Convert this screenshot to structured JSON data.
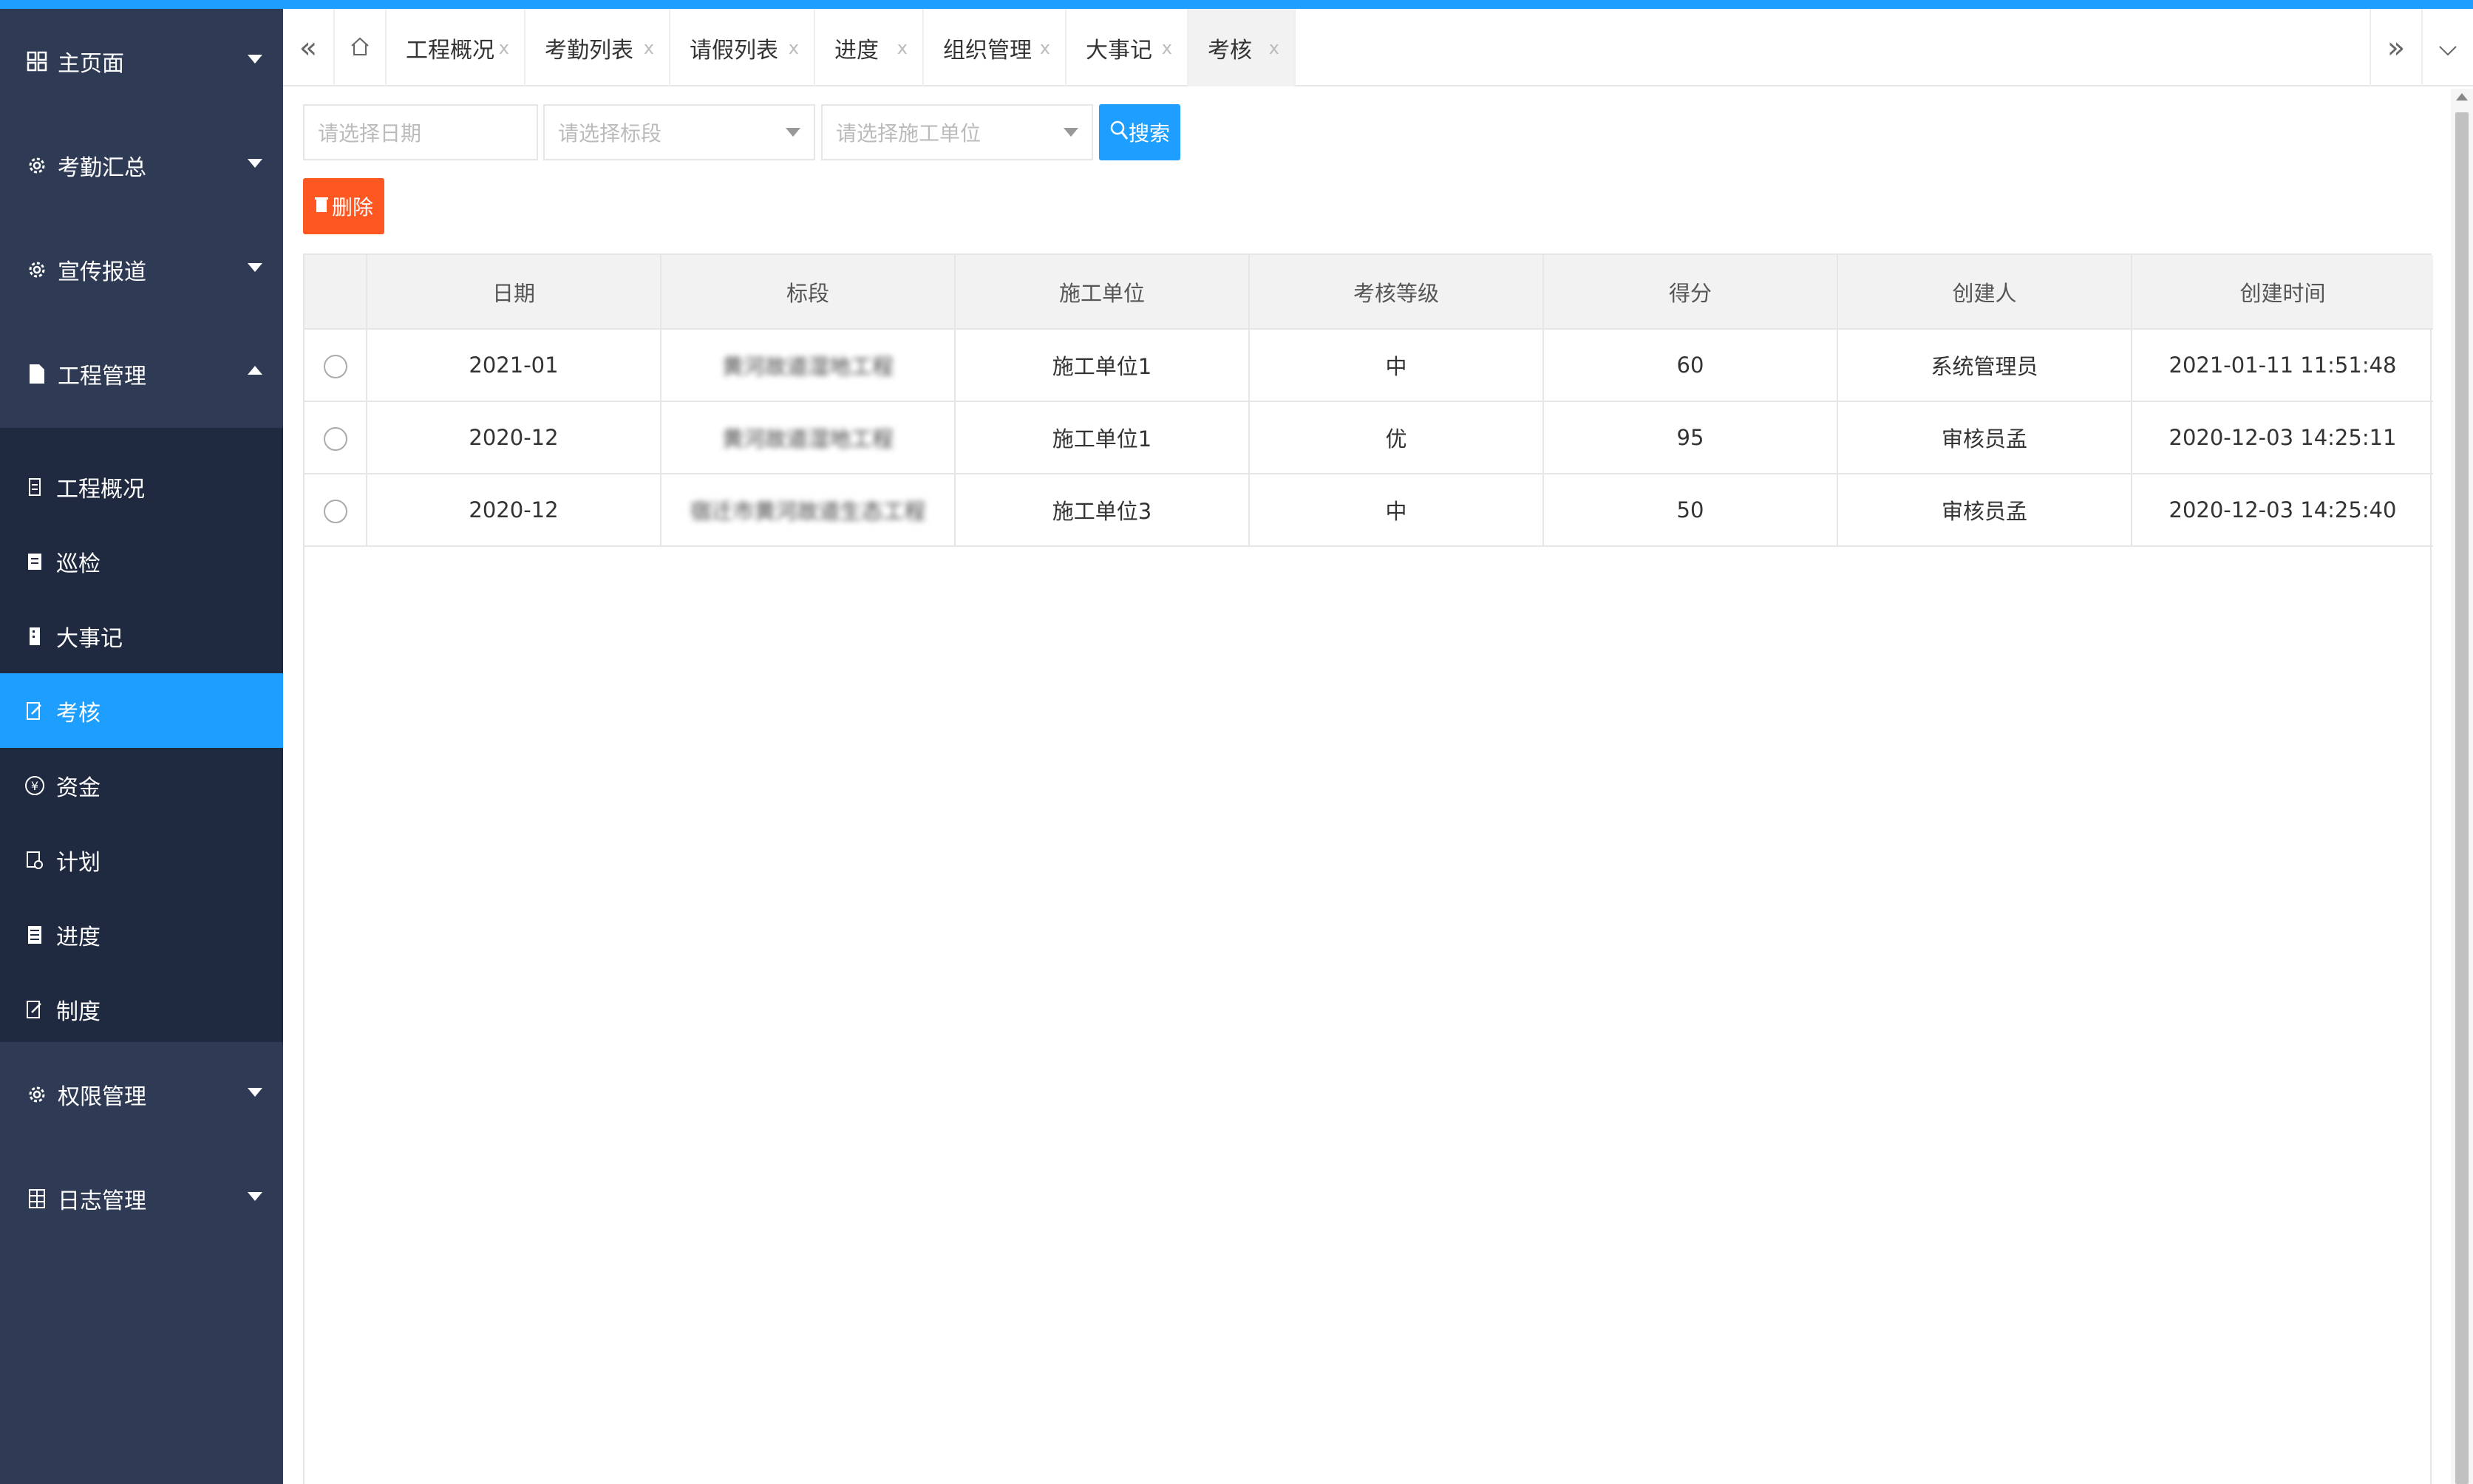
{
  "sidebar": {
    "groups": [
      {
        "label": "主页面",
        "icon": "dashboard-icon"
      },
      {
        "label": "考勤汇总",
        "icon": "gear-icon"
      },
      {
        "label": "宣传报道",
        "icon": "gear-icon"
      },
      {
        "label": "工程管理",
        "icon": "document-icon"
      },
      {
        "label": "权限管理",
        "icon": "gear-icon"
      },
      {
        "label": "日志管理",
        "icon": "grid-icon"
      }
    ],
    "sub_items": [
      {
        "label": "工程概况",
        "icon": "file-icon"
      },
      {
        "label": "巡检",
        "icon": "document-icon"
      },
      {
        "label": "大事记",
        "icon": "building-icon"
      },
      {
        "label": "考核",
        "icon": "edit-doc-icon"
      },
      {
        "label": "资金",
        "icon": "yen-icon"
      },
      {
        "label": "计划",
        "icon": "plan-icon"
      },
      {
        "label": "进度",
        "icon": "list-icon"
      },
      {
        "label": "制度",
        "icon": "edit-doc-icon"
      }
    ],
    "active_item": "考核"
  },
  "tabs": {
    "items": [
      {
        "label": "工程概况",
        "close": "x"
      },
      {
        "label": "考勤列表",
        "close": "x"
      },
      {
        "label": "请假列表",
        "close": "x"
      },
      {
        "label": "进度",
        "close": "x"
      },
      {
        "label": "组织管理",
        "close": "x"
      },
      {
        "label": "大事记",
        "close": "x"
      },
      {
        "label": "考核",
        "close": "x"
      }
    ],
    "active": "考核"
  },
  "toolbar": {
    "date_placeholder": "请选择日期",
    "section_placeholder": "请选择标段",
    "unit_placeholder": "请选择施工单位",
    "search_label": "搜索",
    "delete_label": "删除"
  },
  "table": {
    "columns": [
      "日期",
      "标段",
      "施工单位",
      "考核等级",
      "得分",
      "创建人",
      "创建时间"
    ],
    "rows": [
      {
        "date": "2021-01",
        "section": "黄河故道湿地工程",
        "unit": "施工单位1",
        "grade": "中",
        "score": "60",
        "creator": "系统管理员",
        "created": "2021-01-11 11:51:48"
      },
      {
        "date": "2020-12",
        "section": "黄河故道湿地工程",
        "unit": "施工单位1",
        "grade": "优",
        "score": "95",
        "creator": "审核员孟",
        "created": "2020-12-03 14:25:11"
      },
      {
        "date": "2020-12",
        "section": "宿迁市黄河故道生态工程",
        "unit": "施工单位3",
        "grade": "中",
        "score": "50",
        "creator": "审核员孟",
        "created": "2020-12-03 14:25:40"
      }
    ]
  },
  "colors": {
    "accent": "#1e9fff",
    "danger": "#ff5722",
    "sidebar": "#2f3b55",
    "sidebar_sub": "#1f2940"
  }
}
